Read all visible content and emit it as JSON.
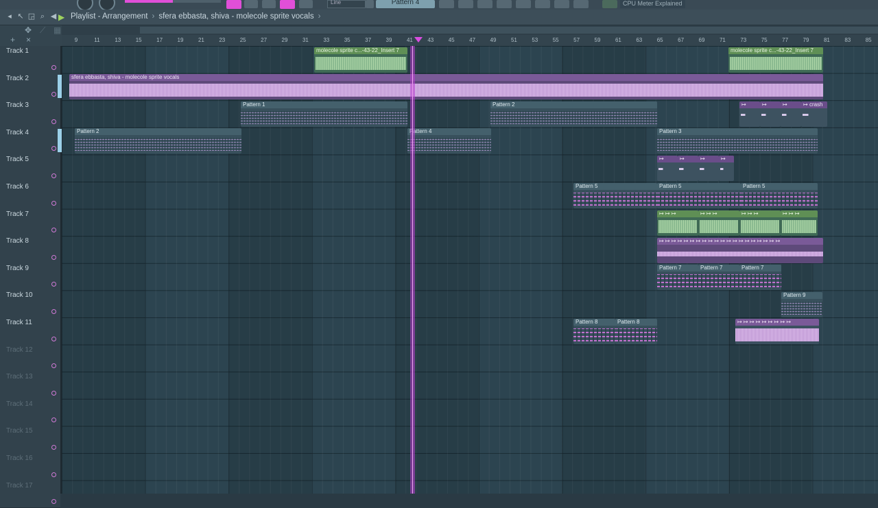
{
  "toolbar": {
    "pattern_selector": "Pattern 4",
    "snap_mode": "Line",
    "cpu_hint": "CPU Meter Explained"
  },
  "titlebar": {
    "window": "Playlist - Arrangement",
    "separator": "›",
    "project": "sfera ebbasta, shiva - molecole sprite vocals",
    "arrow": "›"
  },
  "ruler": {
    "bars": [
      "9",
      "11",
      "13",
      "15",
      "17",
      "19",
      "21",
      "23",
      "25",
      "27",
      "29",
      "31",
      "33",
      "35",
      "37",
      "39",
      "41",
      "43",
      "45",
      "47",
      "49",
      "51",
      "53",
      "55",
      "57",
      "59",
      "61",
      "63",
      "65",
      "67",
      "69",
      "71",
      "73",
      "75",
      "77",
      "79",
      "81",
      "83",
      "85"
    ]
  },
  "tracks": [
    {
      "name": "Track 1"
    },
    {
      "name": "Track 2"
    },
    {
      "name": "Track 3"
    },
    {
      "name": "Track 4"
    },
    {
      "name": "Track 5"
    },
    {
      "name": "Track 6"
    },
    {
      "name": "Track 7"
    },
    {
      "name": "Track 8"
    },
    {
      "name": "Track 9"
    },
    {
      "name": "Track 10"
    },
    {
      "name": "Track 11"
    },
    {
      "name": "Track 12"
    },
    {
      "name": "Track 13"
    },
    {
      "name": "Track 14"
    },
    {
      "name": "Track 15"
    },
    {
      "name": "Track 16"
    },
    {
      "name": "Track 17"
    }
  ],
  "clips": {
    "t1_a": "molecole sprite c...-43-22_Insert 7",
    "t1_b": "molecole sprite c...-43-22_Insert 7",
    "t2_a": "sfera ebbasta, shiva - molecole sprite vocals",
    "t3_a": "Pattern 1",
    "t3_b": "Pattern 2",
    "t3_crash": "crash",
    "t4_a": "Pattern 2",
    "t4_b": "Pattern 4",
    "t4_c": "Pattern 3",
    "t6_a": "Pattern 5",
    "t6_b": "Pattern 5",
    "t6_c": "Pattern 5",
    "t9_a": "Pattern 7",
    "t9_b": "Pattern 7",
    "t9_c": "Pattern 7",
    "t10_a": "Pattern 9",
    "t11_a": "Pattern 8",
    "t11_b": "Pattern 8"
  }
}
